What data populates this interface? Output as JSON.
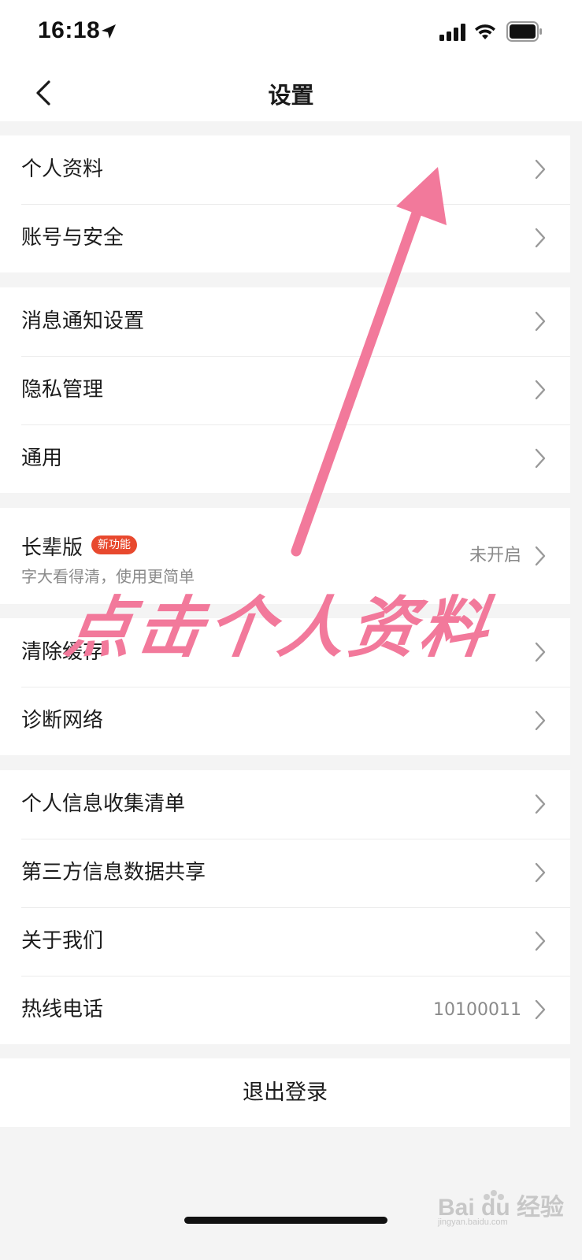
{
  "status_bar": {
    "time": "16:18"
  },
  "nav": {
    "title": "设置"
  },
  "groups": {
    "account": {
      "profile": "个人资料",
      "security": "账号与安全"
    },
    "prefs": {
      "notifications": "消息通知设置",
      "privacy": "隐私管理",
      "general": "通用"
    },
    "elder": {
      "title": "长辈版",
      "badge": "新功能",
      "subtitle": "字大看得清，使用更简单",
      "value": "未开启"
    },
    "tools": {
      "clear_cache": "清除缓存",
      "diagnose": "诊断网络"
    },
    "info": {
      "collection_list": "个人信息收集清单",
      "third_party": "第三方信息数据共享",
      "about": "关于我们",
      "hotline": "热线电话",
      "hotline_value": "10100011"
    }
  },
  "logout": {
    "label": "退出登录"
  },
  "annotation": {
    "text": "点击个人资料",
    "color": "#f2799b"
  },
  "watermark": {
    "text": "Bai du 经验",
    "sub": "jingyan.baidu.com"
  }
}
